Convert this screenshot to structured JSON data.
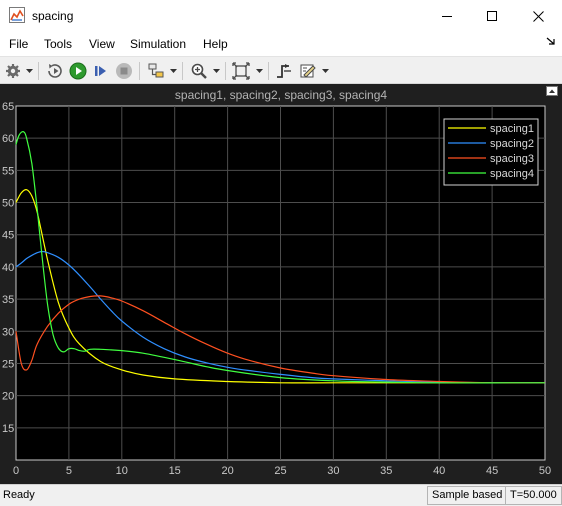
{
  "window": {
    "title": "spacing"
  },
  "menu": {
    "file": "File",
    "tools": "Tools",
    "view": "View",
    "simulation": "Simulation",
    "help": "Help"
  },
  "toolbar": {
    "icons": [
      "gear-icon",
      "step-back-icon",
      "run-icon",
      "step-forward-icon",
      "stop-icon",
      "highlight-icon",
      "zoom-icon",
      "autoscale-icon",
      "triggers-icon",
      "measure-icon"
    ]
  },
  "status": {
    "ready": "Ready",
    "sample_based": "Sample based",
    "time": "T=50.000"
  },
  "chart_data": {
    "type": "line",
    "title": "spacing1, spacing2, spacing3, spacing4",
    "xlabel": "",
    "ylabel": "",
    "xlim": [
      0,
      50
    ],
    "ylim": [
      10,
      65
    ],
    "xticks": [
      "0",
      "5",
      "10",
      "15",
      "20",
      "25",
      "30",
      "35",
      "40",
      "45",
      "50"
    ],
    "yticks": [
      "15",
      "20",
      "25",
      "30",
      "35",
      "40",
      "45",
      "50",
      "55",
      "60",
      "65"
    ],
    "grid": true,
    "legend_position": "top-right",
    "background": "#000000",
    "series": [
      {
        "name": "spacing1",
        "color": "#ffff00",
        "x": [
          0,
          0.5,
          1,
          1.5,
          2,
          3,
          4,
          5,
          6,
          8,
          10,
          12,
          15,
          20,
          25,
          30,
          40,
          50
        ],
        "y": [
          50,
          51.5,
          52,
          51,
          48.5,
          41,
          34.5,
          30.5,
          28,
          25.3,
          24,
          23.2,
          22.6,
          22.2,
          22,
          22,
          22,
          22
        ]
      },
      {
        "name": "spacing2",
        "color": "#2f8fff",
        "x": [
          0,
          0.5,
          1,
          1.5,
          2,
          2.5,
          3,
          4,
          5,
          6,
          7,
          8,
          9,
          10,
          12,
          14,
          16,
          18,
          20,
          22,
          25,
          28,
          30,
          35,
          40,
          45,
          50
        ],
        "y": [
          40,
          40.6,
          41.3,
          41.8,
          42.2,
          42.4,
          42.2,
          41.5,
          40.3,
          38.7,
          36.9,
          35,
          33.2,
          31.6,
          29.1,
          27.3,
          26,
          25.1,
          24.4,
          23.9,
          23.3,
          22.8,
          22.6,
          22.3,
          22.1,
          22,
          22
        ]
      },
      {
        "name": "spacing3",
        "color": "#ff5020",
        "x": [
          0,
          0.5,
          1,
          1.5,
          2,
          3,
          4,
          5,
          6,
          7,
          8,
          9,
          10,
          12,
          14,
          16,
          18,
          20,
          22,
          25,
          28,
          30,
          35,
          40,
          45,
          50
        ],
        "y": [
          30,
          25,
          24,
          25.5,
          28,
          30.8,
          32.8,
          34.2,
          35,
          35.4,
          35.5,
          35.2,
          34.7,
          33.2,
          31.4,
          29.6,
          28,
          26.6,
          25.5,
          24.3,
          23.5,
          23.1,
          22.5,
          22.2,
          22,
          22
        ]
      },
      {
        "name": "spacing4",
        "color": "#40ff40",
        "x": [
          0,
          0.3,
          0.7,
          1,
          1.5,
          2,
          2.5,
          3,
          3.5,
          4,
          4.5,
          5,
          5.5,
          6,
          6.5,
          7,
          8,
          9,
          10,
          12,
          15,
          18,
          20,
          25,
          30,
          35,
          40,
          50
        ],
        "y": [
          59,
          60.5,
          61,
          60,
          56,
          49,
          41,
          34,
          29.5,
          27.4,
          26.8,
          27.3,
          27.3,
          27,
          26.9,
          27.2,
          27.2,
          27.1,
          27,
          26.6,
          25.6,
          24.5,
          23.9,
          22.8,
          22.3,
          22.1,
          22,
          22
        ]
      }
    ]
  }
}
